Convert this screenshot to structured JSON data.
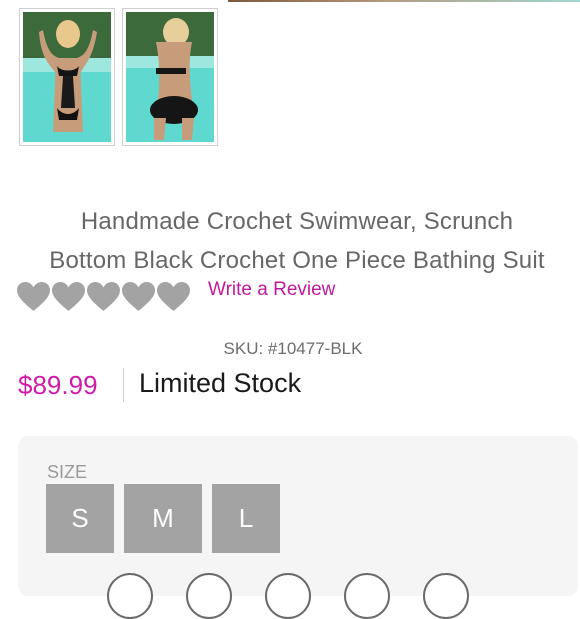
{
  "product": {
    "title_line1": "Handmade Crochet Swimwear, Scrunch",
    "title_line2": "Bottom Black Crochet One Piece Bathing Suit",
    "rating": 5,
    "write_review_label": "Write a Review",
    "sku": "SKU: #10477-BLK",
    "price": "$89.99",
    "stock_status": "Limited Stock"
  },
  "gallery": {
    "thumbnails": [
      {
        "name": "front-view"
      },
      {
        "name": "back-view"
      }
    ]
  },
  "size_selector": {
    "label": "SIZE",
    "options": [
      "S",
      "M",
      "L"
    ]
  },
  "colors": {
    "accent": "#d11ba8",
    "heart": "#a3a3a3",
    "size_button": "#a3a3a3",
    "panel": "#f5f5f5"
  }
}
